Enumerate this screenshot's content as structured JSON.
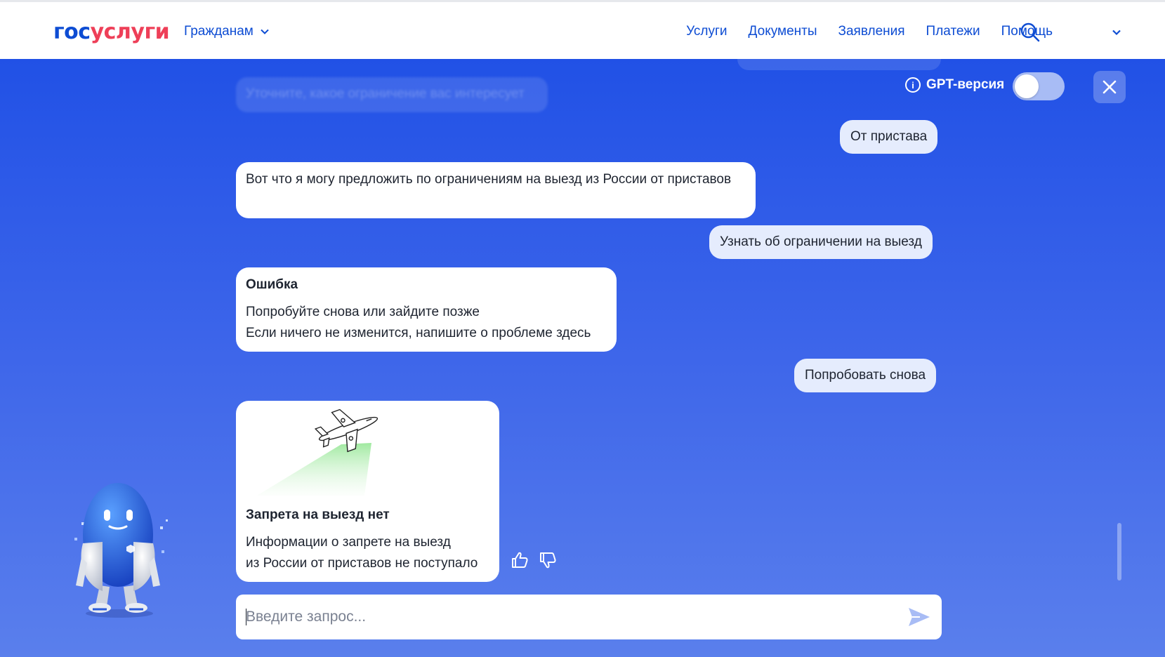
{
  "header": {
    "logo_part1": "гос",
    "logo_part2": "услуги",
    "citizens_label": "Гражданам",
    "nav": [
      "Услуги",
      "Документы",
      "Заявления",
      "Платежи",
      "Помощь"
    ],
    "colors": {
      "brand_blue": "#0d4cd3",
      "brand_red": "#ee3f58"
    }
  },
  "chat": {
    "ghost_message": "Уточните, какое ограничение вас интересует",
    "gpt_label": "GPT-версия",
    "gpt_enabled": false,
    "messages": [
      {
        "role": "user",
        "text": "От пристава"
      },
      {
        "role": "bot",
        "text": "Вот что я могу предложить по ограничениям на выезд из России от приставов"
      },
      {
        "role": "user",
        "text": "Узнать об ограничении на выезд"
      },
      {
        "role": "bot",
        "title": "Ошибка",
        "lines": [
          "Попробуйте снова или зайдите позже",
          "Если ничего не изменится, напишите о проблеме здесь"
        ]
      },
      {
        "role": "user",
        "text": "Попробовать снова"
      },
      {
        "role": "bot",
        "image": "airplane-illustration",
        "title": "Запрета на выезд нет",
        "lines": [
          "Информации о запрете на выезд",
          "из России от приставов не поступало"
        ]
      }
    ],
    "input": {
      "value": "",
      "placeholder": "Введите запрос..."
    },
    "icons": [
      "info-icon",
      "close-icon",
      "thumbs-up-icon",
      "thumbs-down-icon",
      "send-icon",
      "search-icon",
      "chevron-down-icon",
      "robot-assistant"
    ]
  }
}
